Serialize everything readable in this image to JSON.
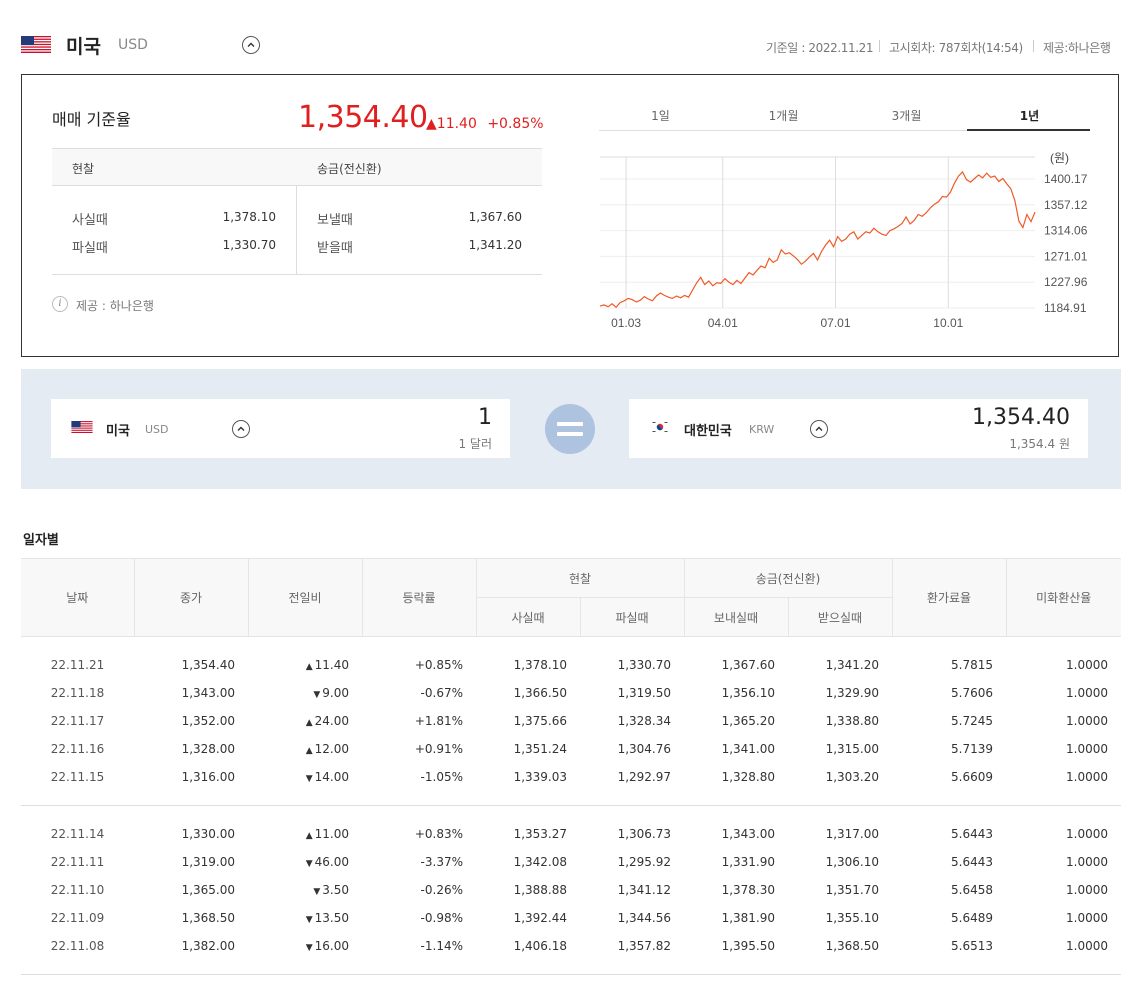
{
  "header": {
    "country": "미국",
    "code": "USD",
    "date_text": "기준일 : 2022.11.21",
    "notice_text": "고시회차: 787회차(14:54)",
    "provider_text": "제공:하나은행"
  },
  "summary": {
    "title": "매매 기준율",
    "rate": "1,354.40",
    "change": "11.40",
    "change_pct": "+0.85%",
    "cash_header": "현찰",
    "remit_header": "송금(전신환)",
    "buy_cash_label": "사실때",
    "buy_cash_value": "1,378.10",
    "sell_cash_label": "파실때",
    "sell_cash_value": "1,330.70",
    "send_label": "보낼때",
    "send_value": "1,367.60",
    "receive_label": "받을때",
    "receive_value": "1,341.20",
    "provider_note": "제공 : 하나은행"
  },
  "tabs": [
    "1일",
    "1개월",
    "3개월",
    "1년"
  ],
  "active_tab": "1년",
  "chart_data": {
    "type": "line",
    "ylabel": "(원)",
    "y_ticks": [
      "1400.17",
      "1357.12",
      "1314.06",
      "1271.01",
      "1227.96",
      "1184.91"
    ],
    "x_ticks": [
      "01.03",
      "04.01",
      "07.01",
      "10.01"
    ],
    "ylim": [
      1184.91,
      1400.17
    ],
    "series": [
      {
        "values": [
          1188,
          1190,
          1187,
          1192,
          1186,
          1194,
          1197,
          1201,
          1199,
          1195,
          1198,
          1204,
          1200,
          1197,
          1205,
          1210,
          1206,
          1203,
          1201,
          1205,
          1202,
          1206,
          1203,
          1215,
          1227,
          1236,
          1224,
          1230,
          1222,
          1227,
          1226,
          1234,
          1228,
          1224,
          1231,
          1226,
          1235,
          1244,
          1240,
          1248,
          1255,
          1252,
          1268,
          1261,
          1265,
          1282,
          1275,
          1277,
          1272,
          1266,
          1258,
          1263,
          1270,
          1276,
          1265,
          1279,
          1290,
          1298,
          1287,
          1304,
          1296,
          1300,
          1308,
          1312,
          1300,
          1306,
          1312,
          1310,
          1318,
          1312,
          1308,
          1306,
          1314,
          1317,
          1321,
          1326,
          1337,
          1325,
          1331,
          1341,
          1338,
          1344,
          1352,
          1358,
          1362,
          1371,
          1370,
          1378,
          1393,
          1405,
          1412,
          1399,
          1395,
          1401,
          1407,
          1402,
          1410,
          1403,
          1405,
          1396,
          1401,
          1392,
          1384,
          1364,
          1330,
          1319,
          1341,
          1329,
          1345
        ]
      }
    ]
  },
  "converter": {
    "from_country": "미국",
    "from_code": "USD",
    "from_amount": "1",
    "from_sub": "1 달러",
    "to_country": "대한민국",
    "to_code": "KRW",
    "to_amount": "1,354.40",
    "to_sub": "1,354.4 원"
  },
  "daily": {
    "title": "일자별",
    "headers": {
      "date": "날짜",
      "close": "종가",
      "diff": "전일비",
      "rate": "등락률",
      "cash": "현찰",
      "cash_buy": "사실때",
      "cash_sell": "파실때",
      "remit": "송금(전신환)",
      "remit_send": "보내실때",
      "remit_recv": "받으실때",
      "exchange_fee": "환가료율",
      "usd_rate": "미화환산율"
    },
    "groups": [
      [
        {
          "date": "22.11.21",
          "close": "1,354.40",
          "dir": "up",
          "diff": "11.40",
          "pct": "+0.85%",
          "cash_buy": "1,378.10",
          "cash_sell": "1,330.70",
          "send": "1,367.60",
          "recv": "1,341.20",
          "fee": "5.7815",
          "usd": "1.0000"
        },
        {
          "date": "22.11.18",
          "close": "1,343.00",
          "dir": "down",
          "diff": "9.00",
          "pct": "-0.67%",
          "cash_buy": "1,366.50",
          "cash_sell": "1,319.50",
          "send": "1,356.10",
          "recv": "1,329.90",
          "fee": "5.7606",
          "usd": "1.0000"
        },
        {
          "date": "22.11.17",
          "close": "1,352.00",
          "dir": "up",
          "diff": "24.00",
          "pct": "+1.81%",
          "cash_buy": "1,375.66",
          "cash_sell": "1,328.34",
          "send": "1,365.20",
          "recv": "1,338.80",
          "fee": "5.7245",
          "usd": "1.0000"
        },
        {
          "date": "22.11.16",
          "close": "1,328.00",
          "dir": "up",
          "diff": "12.00",
          "pct": "+0.91%",
          "cash_buy": "1,351.24",
          "cash_sell": "1,304.76",
          "send": "1,341.00",
          "recv": "1,315.00",
          "fee": "5.7139",
          "usd": "1.0000"
        },
        {
          "date": "22.11.15",
          "close": "1,316.00",
          "dir": "down",
          "diff": "14.00",
          "pct": "-1.05%",
          "cash_buy": "1,339.03",
          "cash_sell": "1,292.97",
          "send": "1,328.80",
          "recv": "1,303.20",
          "fee": "5.6609",
          "usd": "1.0000"
        }
      ],
      [
        {
          "date": "22.11.14",
          "close": "1,330.00",
          "dir": "up",
          "diff": "11.00",
          "pct": "+0.83%",
          "cash_buy": "1,353.27",
          "cash_sell": "1,306.73",
          "send": "1,343.00",
          "recv": "1,317.00",
          "fee": "5.6443",
          "usd": "1.0000"
        },
        {
          "date": "22.11.11",
          "close": "1,319.00",
          "dir": "down",
          "diff": "46.00",
          "pct": "-3.37%",
          "cash_buy": "1,342.08",
          "cash_sell": "1,295.92",
          "send": "1,331.90",
          "recv": "1,306.10",
          "fee": "5.6443",
          "usd": "1.0000"
        },
        {
          "date": "22.11.10",
          "close": "1,365.00",
          "dir": "down",
          "diff": "3.50",
          "pct": "-0.26%",
          "cash_buy": "1,388.88",
          "cash_sell": "1,341.12",
          "send": "1,378.30",
          "recv": "1,351.70",
          "fee": "5.6458",
          "usd": "1.0000"
        },
        {
          "date": "22.11.09",
          "close": "1,368.50",
          "dir": "down",
          "diff": "13.50",
          "pct": "-0.98%",
          "cash_buy": "1,392.44",
          "cash_sell": "1,344.56",
          "send": "1,381.90",
          "recv": "1,355.10",
          "fee": "5.6489",
          "usd": "1.0000"
        },
        {
          "date": "22.11.08",
          "close": "1,382.00",
          "dir": "down",
          "diff": "16.00",
          "pct": "-1.14%",
          "cash_buy": "1,406.18",
          "cash_sell": "1,357.82",
          "send": "1,395.50",
          "recv": "1,368.50",
          "fee": "5.6513",
          "usd": "1.0000"
        }
      ]
    ]
  },
  "colors": {
    "up": "#e02020",
    "down": "#2b5fd6",
    "line": "#f05a28",
    "converter_bg": "#e5ebf2"
  }
}
